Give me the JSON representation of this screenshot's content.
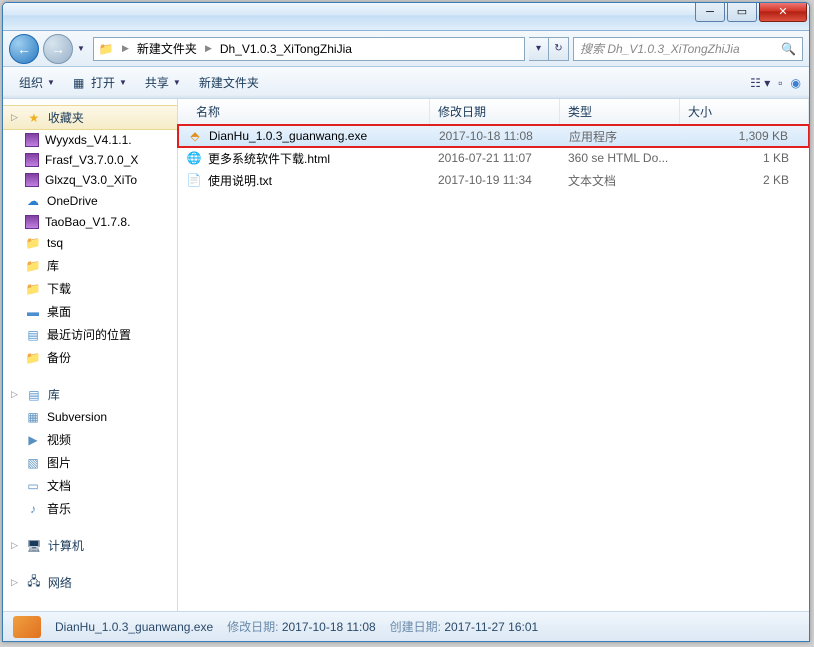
{
  "breadcrumb": {
    "seg1": "新建文件夹",
    "seg2": "Dh_V1.0.3_XiTongZhiJia"
  },
  "search_placeholder": "搜索 Dh_V1.0.3_XiTongZhiJia",
  "toolbar": {
    "org": "组织",
    "open": "打开",
    "share": "共享",
    "newfolder": "新建文件夹"
  },
  "columns": {
    "name": "名称",
    "date": "修改日期",
    "type": "类型",
    "size": "大小"
  },
  "tree": {
    "fav": "收藏夹",
    "fav_items": [
      "Wyyxds_V4.1.1.",
      "Frasf_V3.7.0.0_X",
      "Glxzq_V3.0_XiTo",
      "OneDrive",
      "TaoBao_V1.7.8.",
      "tsq",
      "库",
      "下载",
      "桌面",
      "最近访问的位置",
      "备份"
    ],
    "lib": "库",
    "lib_items": [
      "Subversion",
      "视频",
      "图片",
      "文档",
      "音乐"
    ],
    "pc": "计算机",
    "net": "网络"
  },
  "files": [
    {
      "name": "DianHu_1.0.3_guanwang.exe",
      "date": "2017-10-18 11:08",
      "type": "应用程序",
      "size": "1,309 KB",
      "icon": "exe",
      "selected": true,
      "highlight": true
    },
    {
      "name": "更多系统软件下载.html",
      "date": "2016-07-21 11:07",
      "type": "360 se HTML Do...",
      "size": "1 KB",
      "icon": "html"
    },
    {
      "name": "使用说明.txt",
      "date": "2017-10-19 11:34",
      "type": "文本文档",
      "size": "2 KB",
      "icon": "txt"
    }
  ],
  "status": {
    "filename": "DianHu_1.0.3_guanwang.exe",
    "mod_label": "修改日期:",
    "mod_value": "2017-10-18 11:08",
    "create_label": "创建日期:",
    "create_value": "2017-11-27 16:01"
  }
}
